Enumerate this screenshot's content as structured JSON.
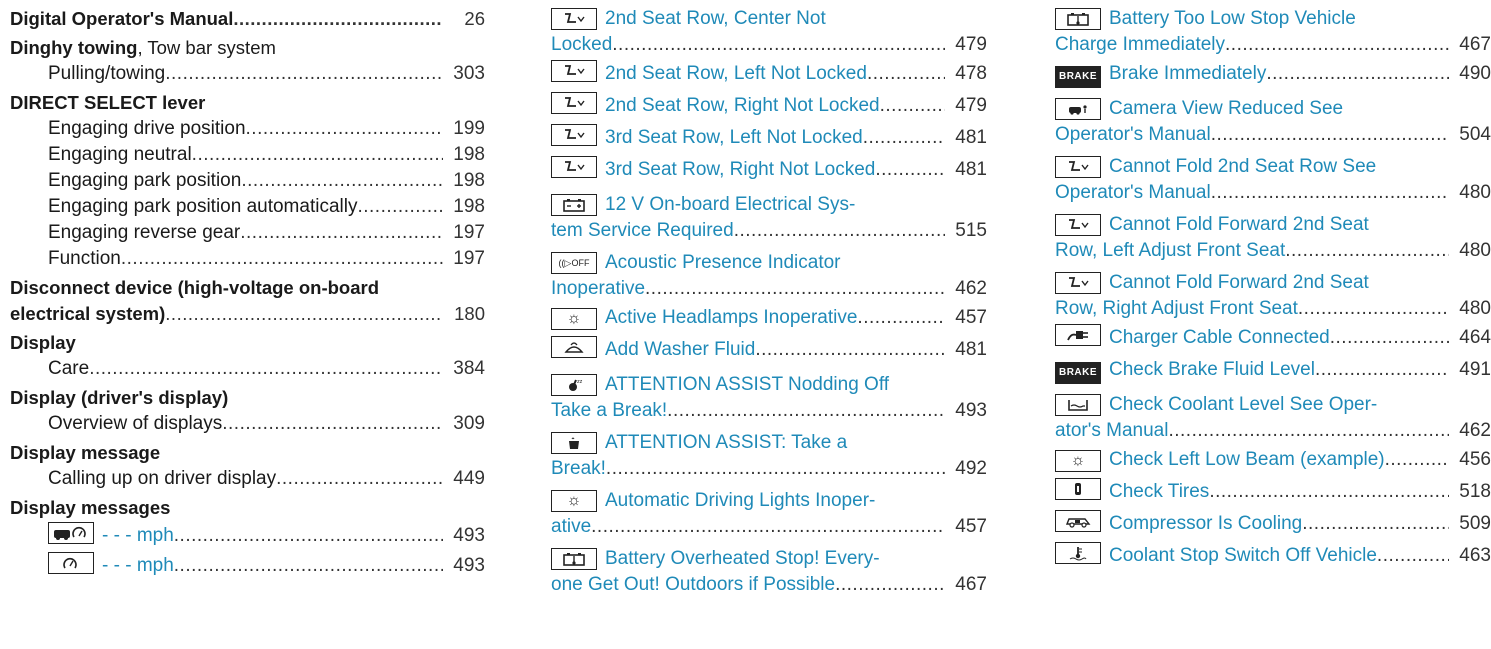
{
  "col1": {
    "e1": {
      "title": "Digital Operator's Manual",
      "page": "26"
    },
    "e2": {
      "title": "Dinghy towing",
      "suffix": ", Tow bar system",
      "sub": {
        "label": "Pulling/towing",
        "page": "303"
      }
    },
    "e3": {
      "title": "DIRECT SELECT lever",
      "subs": [
        {
          "label": "Engaging drive position",
          "page": "199"
        },
        {
          "label": "Engaging neutral",
          "page": "198"
        },
        {
          "label": "Engaging park position",
          "page": "198"
        },
        {
          "label": "Engaging park position automatically",
          "page": "198"
        },
        {
          "label": "Engaging reverse gear",
          "page": "197"
        },
        {
          "label": "Function",
          "page": "197"
        }
      ]
    },
    "e4": {
      "title_line1": "Disconnect device (high-voltage on-board",
      "title_line2": "electrical system)",
      "page": "180"
    },
    "e5": {
      "title": "Display",
      "sub": {
        "label": "Care",
        "page": "384"
      }
    },
    "e6": {
      "title": "Display (driver's display)",
      "sub": {
        "label": "Overview of displays",
        "page": "309"
      }
    },
    "e7": {
      "title": "Display message",
      "sub": {
        "label": "Calling up on driver display",
        "page": "449"
      }
    },
    "e8": {
      "title": "Display messages",
      "subs": [
        {
          "icon": "car-speed-warning-icon",
          "label": "- - - mph",
          "page": "493"
        },
        {
          "icon": "speedometer-icon",
          "label": "- - - mph",
          "page": "493"
        }
      ]
    }
  },
  "col2": [
    {
      "icon": "seat-icon",
      "line1": "2nd Seat Row, Center Not",
      "line2": "Locked",
      "page": "479"
    },
    {
      "icon": "seat-icon",
      "line1": "2nd Seat Row, Left Not Locked",
      "page": "478"
    },
    {
      "icon": "seat-icon",
      "line1": "2nd Seat Row, Right Not Locked",
      "page": "479"
    },
    {
      "icon": "seat-icon",
      "line1": "3rd Seat Row, Left Not Locked",
      "page": "481"
    },
    {
      "icon": "seat-icon",
      "line1": "3rd Seat Row, Right Not Locked",
      "page": "481"
    },
    {
      "icon": "battery-icon",
      "line1": "12 V On-board Electrical Sys-",
      "line2": "tem Service Required",
      "page": "515"
    },
    {
      "icon": "acoustic-presence-off-icon",
      "icon_text": "((▷OFF",
      "line1": "Acoustic Presence Indicator",
      "line2": "Inoperative",
      "page": "462"
    },
    {
      "icon": "headlamp-icon",
      "line1": "Active Headlamps Inoperative",
      "page": "457"
    },
    {
      "icon": "washer-fluid-icon",
      "line1": "Add Washer Fluid",
      "page": "481"
    },
    {
      "icon": "attention-assist-icon",
      "line1": "ATTENTION ASSIST Nodding Off",
      "line2": "Take a Break!",
      "page": "493"
    },
    {
      "icon": "coffee-cup-icon",
      "line1": "ATTENTION ASSIST: Take a",
      "line2": "Break!",
      "page": "492"
    },
    {
      "icon": "headlamp-icon",
      "line1": "Automatic Driving Lights Inoper-",
      "line2": "ative",
      "page": "457"
    },
    {
      "icon": "battery-temp-icon",
      "line1": "Battery Overheated Stop! Every-",
      "line2": "one Get Out! Outdoors if Possible",
      "page": "467"
    }
  ],
  "col3": [
    {
      "icon": "battery-temp-icon",
      "line1": "Battery Too Low Stop Vehicle",
      "line2": "Charge Immediately",
      "page": "467"
    },
    {
      "icon": "brake-icon",
      "icon_text": "BRAKE",
      "line1": "Brake Immediately",
      "page": "490"
    },
    {
      "icon": "camera-icon",
      "line1": "Camera View Reduced See",
      "line2": "Operator's Manual",
      "page": "504"
    },
    {
      "icon": "seat-icon",
      "line1": "Cannot Fold 2nd Seat Row See",
      "line2": "Operator's Manual",
      "page": "480"
    },
    {
      "icon": "seat-icon",
      "line1": "Cannot Fold Forward 2nd Seat",
      "line2": "Row, Left Adjust Front Seat",
      "page": "480"
    },
    {
      "icon": "seat-icon",
      "line1": "Cannot Fold Forward 2nd Seat",
      "line2": "Row, Right Adjust Front Seat",
      "page": "480"
    },
    {
      "icon": "charger-cable-icon",
      "line1": "Charger Cable Connected",
      "page": "464"
    },
    {
      "icon": "brake-icon",
      "icon_text": "BRAKE",
      "line1": "Check Brake Fluid Level",
      "page": "491"
    },
    {
      "icon": "coolant-icon",
      "line1": "Check Coolant Level See Oper-",
      "line2": "ator's Manual",
      "page": "462"
    },
    {
      "icon": "headlamp-icon",
      "line1": "Check Left Low Beam (example)",
      "page": "456"
    },
    {
      "icon": "tire-pressure-icon",
      "line1": "Check Tires",
      "page": "518"
    },
    {
      "icon": "compressor-icon",
      "line1": "Compressor Is Cooling",
      "page": "509"
    },
    {
      "icon": "coolant-temp-icon",
      "line1": "Coolant Stop Switch Off Vehicle",
      "page": "463"
    }
  ]
}
